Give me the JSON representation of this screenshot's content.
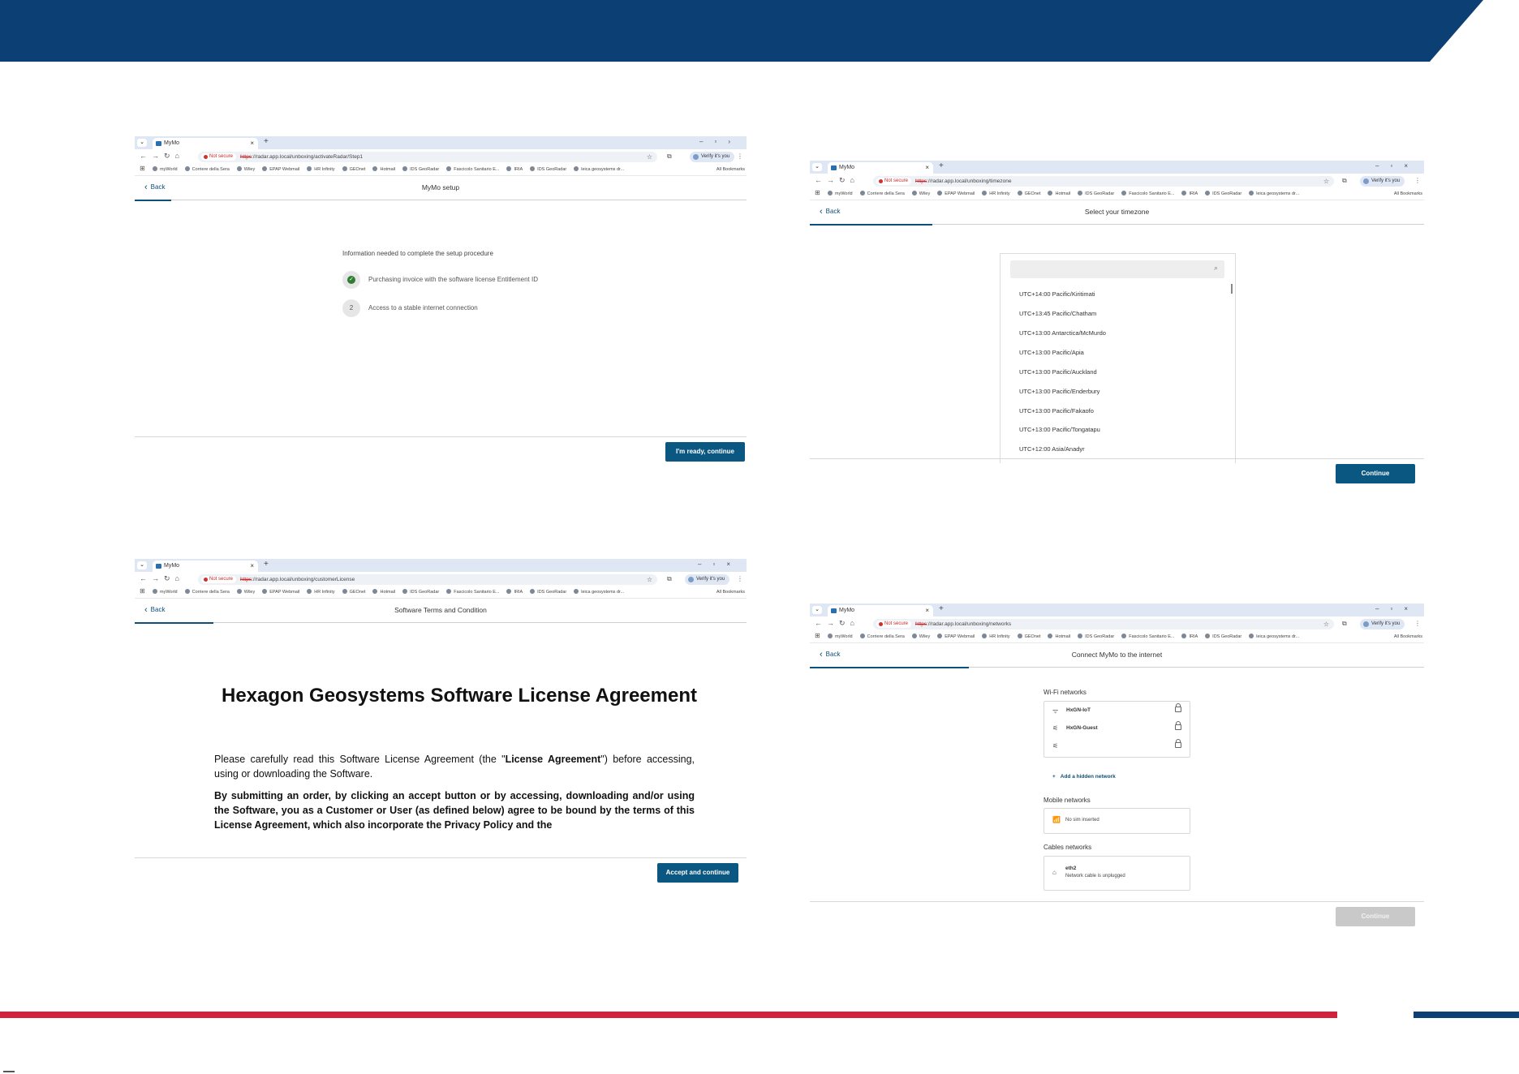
{
  "colors": {
    "brand_blue": "#0c3f74",
    "accent_red": "#d4213b",
    "button_blue": "#0a5782",
    "success_green": "#2e7d32"
  },
  "browser": {
    "tab_title": "MyMo",
    "not_secure": "Not secure",
    "url_scheme": "https",
    "verify": "Verify it's you",
    "bookmarks": [
      "myWorld",
      "Corriere della Sera",
      "Wiley",
      "EPAP Webmail",
      "HR Infinity",
      "GEOnet",
      "Hotmail",
      "IDS GeoRadar",
      "Fascicolo Sanitario E...",
      "IRIA",
      "IDS GeoRadar",
      "leica geosystems dr..."
    ],
    "all_bookmarks": "All Bookmarks"
  },
  "shot_setup": {
    "url": "://radar.app.local/unboxing/activateRadar/Step1",
    "back": "Back",
    "title": "MyMo setup",
    "info": "Information needed to complete the setup procedure",
    "steps": [
      {
        "marker": "✓",
        "label": "Purchasing invoice with the software license Entitlement ID"
      },
      {
        "marker": "2",
        "label": "Access to a stable internet connection"
      }
    ],
    "button": "I'm ready, continue"
  },
  "shot_timezone": {
    "url": "://radar.app.local/unboxing/timezone",
    "back": "Back",
    "title": "Select your timezone",
    "timezones": [
      "UTC+14:00 Pacific/Kiritimati",
      "UTC+13:45 Pacific/Chatham",
      "UTC+13:00 Antarctica/McMurdo",
      "UTC+13:00 Pacific/Apia",
      "UTC+13:00 Pacific/Auckland",
      "UTC+13:00 Pacific/Enderbury",
      "UTC+13:00 Pacific/Fakaofo",
      "UTC+13:00 Pacific/Tongatapu",
      "UTC+12:00 Asia/Anadyr"
    ],
    "button": "Continue"
  },
  "shot_license": {
    "url": "://radar.app.local/unboxing/customerLicense",
    "back": "Back",
    "title": "Software Terms and Condition",
    "heading": "Hexagon Geosystems Software License Agreement",
    "p1_pre": "Please carefully read this Software License Agreement (the \"",
    "p1_bold": "License Agreement",
    "p1_post": "\") before accessing, using or downloading the Software.",
    "p2": "By submitting an order, by clicking an accept button or by accessing, downloading and/or using the Software, you as a Customer or User (as defined below) agree to be bound by the terms of this License Agreement, which also incorporate the Privacy Policy and the",
    "button": "Accept and continue"
  },
  "shot_network": {
    "url": "://radar.app.local/unboxing/networks",
    "back": "Back",
    "title": "Connect MyMo to the internet",
    "wifi_label": "Wi-Fi networks",
    "wifi": [
      {
        "name": "HxGN-IoT",
        "icon": "wifi-icon"
      },
      {
        "name": "HxGN-Guest",
        "icon": "wifi-off-icon"
      },
      {
        "name": "",
        "icon": "wifi-off-icon"
      }
    ],
    "add_hidden": "Add a hidden network",
    "mobile_label": "Mobile networks",
    "mobile_status": "No sim inserted",
    "cable_label": "Cables networks",
    "cable_name": "eth2",
    "cable_status": "Network cable is unplugged",
    "button": "Continue"
  }
}
